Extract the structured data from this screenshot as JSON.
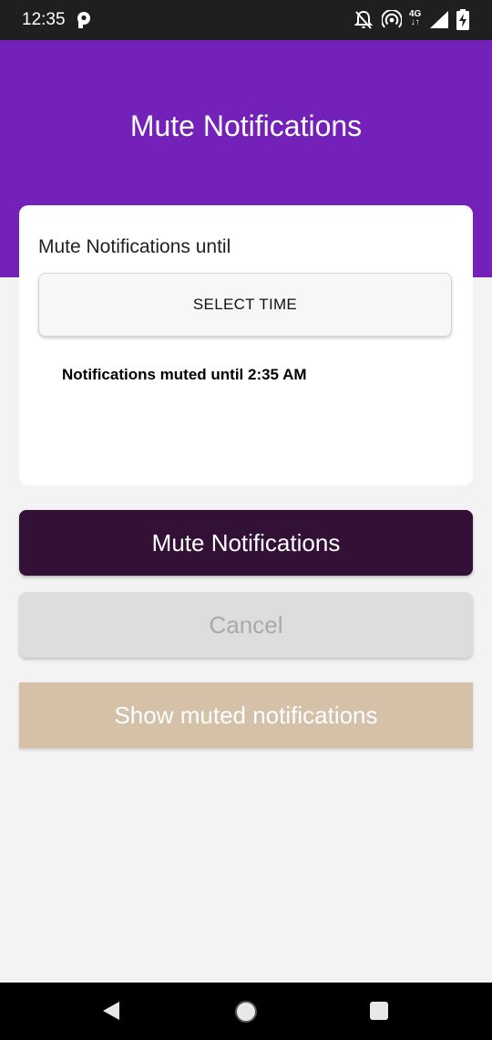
{
  "status_bar": {
    "time": "12:35",
    "network_label": "4G",
    "icons": [
      "parking-app-icon",
      "notifications-off-icon",
      "hotspot-icon",
      "data-arrows-icon",
      "signal-icon",
      "battery-charging-icon"
    ]
  },
  "header": {
    "title": "Mute Notifications",
    "background_color": "#7321b8"
  },
  "card": {
    "label": "Mute Notifications until",
    "select_time_label": "SELECT TIME",
    "muted_status": "Notifications muted until 2:35 AM"
  },
  "actions": {
    "mute_label": "Mute Notifications",
    "cancel_label": "Cancel",
    "show_muted_label": "Show muted notifications"
  },
  "colors": {
    "mute_button": "#331137",
    "cancel_button": "#dddddd",
    "show_muted_button": "#d5c0a8"
  },
  "nav_bar": {
    "icons": [
      "back-icon",
      "home-icon",
      "recents-icon"
    ]
  }
}
